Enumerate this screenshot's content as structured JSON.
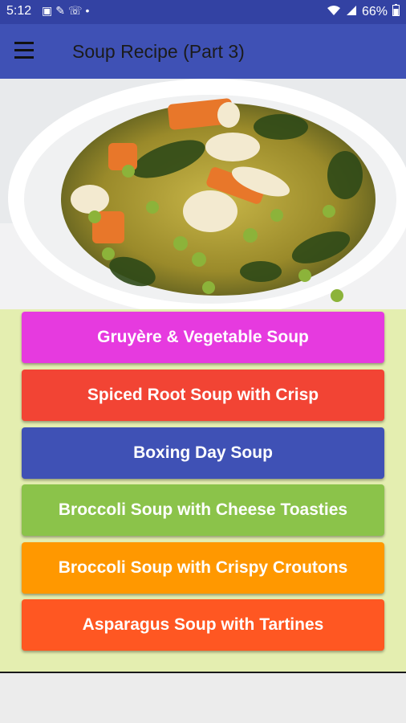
{
  "status": {
    "time": "5:12",
    "battery": "66%"
  },
  "header": {
    "title": "Soup Recipe (Part 3)"
  },
  "recipes": [
    {
      "label": "Gruyère & Vegetable Soup",
      "color": "#e63adf"
    },
    {
      "label": "Spiced Root Soup with Crisp",
      "color": "#f24434"
    },
    {
      "label": "Boxing Day Soup",
      "color": "#3f51b5"
    },
    {
      "label": "Broccoli Soup with Cheese Toasties",
      "color": "#8bc34a"
    },
    {
      "label": "Broccoli Soup with Crispy Croutons",
      "color": "#ff9800"
    },
    {
      "label": "Asparagus Soup with Tartines",
      "color": "#ff5722"
    }
  ],
  "colors": {
    "status_bar": "#3342a3",
    "app_bar": "#3f51b5",
    "content_bg": "#e4eeb0"
  }
}
